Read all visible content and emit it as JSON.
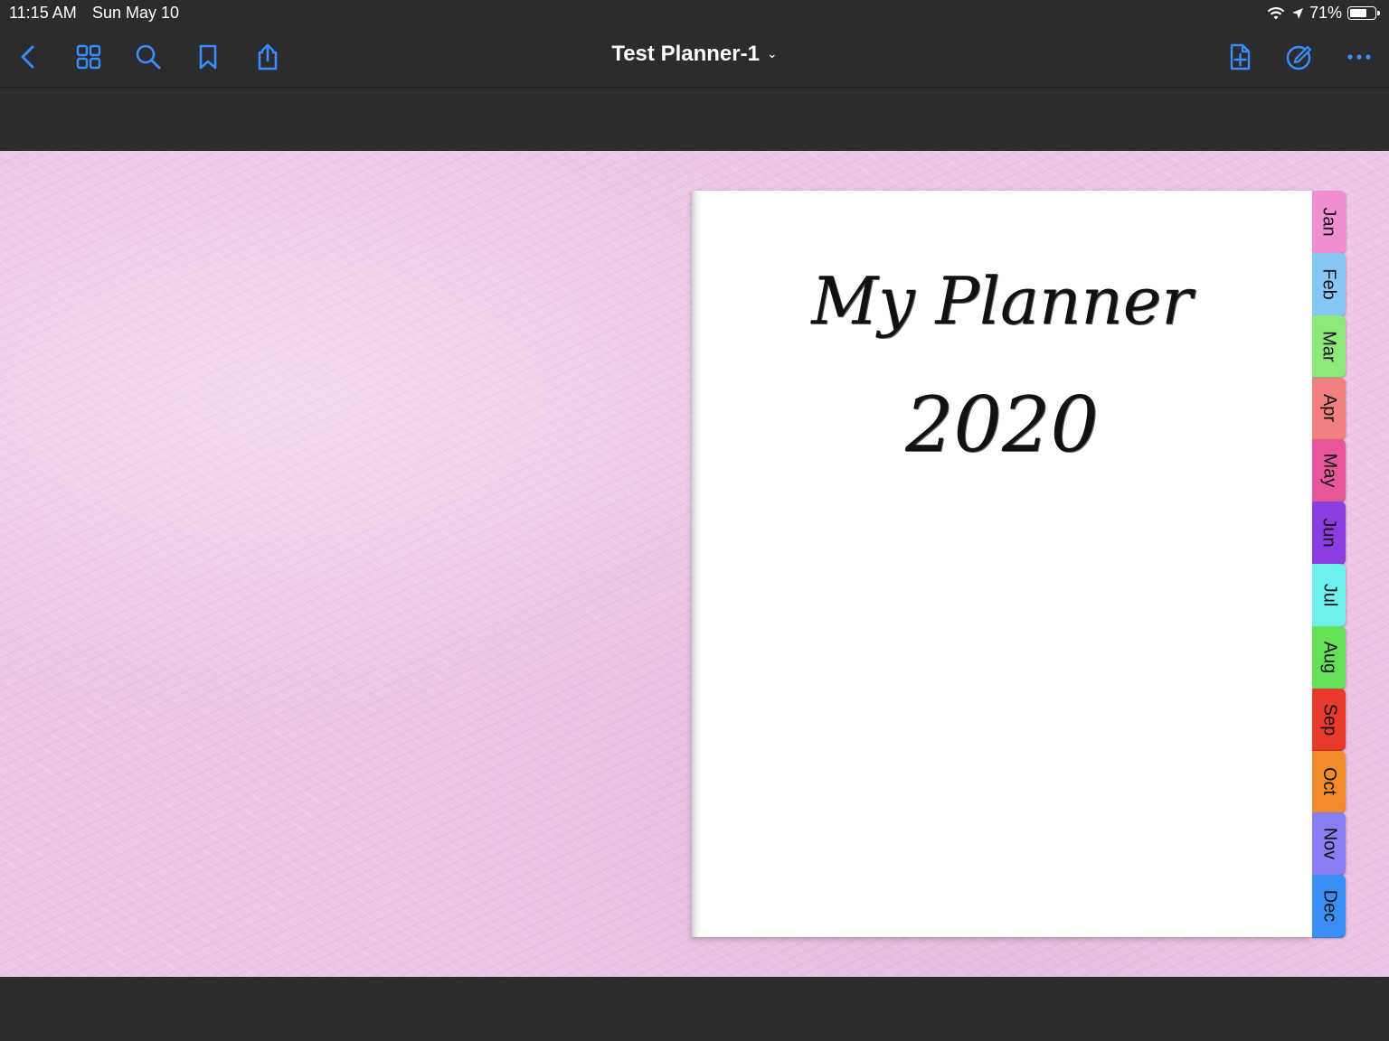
{
  "status_bar": {
    "time": "11:15 AM",
    "date": "Sun May 10",
    "battery": "71%",
    "battery_level": 0.71
  },
  "toolbar": {
    "title": "Test Planner-1",
    "accent_color": "#3a8dff",
    "left_icons": [
      "back-icon",
      "grid-icon",
      "search-icon",
      "bookmark-icon",
      "share-icon"
    ],
    "right_icons": [
      "add-page-icon",
      "annotate-icon",
      "more-icon"
    ]
  },
  "planner": {
    "title": "My Planner",
    "year": "2020",
    "tabs": [
      {
        "label": "Jan",
        "color": "#f08fd0"
      },
      {
        "label": "Feb",
        "color": "#85c8f5"
      },
      {
        "label": "Mar",
        "color": "#8fe87a"
      },
      {
        "label": "Apr",
        "color": "#f28080"
      },
      {
        "label": "May",
        "color": "#e8569a"
      },
      {
        "label": "Jun",
        "color": "#8a3ee0"
      },
      {
        "label": "Jul",
        "color": "#6ff0f0"
      },
      {
        "label": "Aug",
        "color": "#66e05a"
      },
      {
        "label": "Sep",
        "color": "#e8392a"
      },
      {
        "label": "Oct",
        "color": "#f28c2a"
      },
      {
        "label": "Nov",
        "color": "#8a7ef5"
      },
      {
        "label": "Dec",
        "color": "#3a8ef5"
      }
    ]
  }
}
